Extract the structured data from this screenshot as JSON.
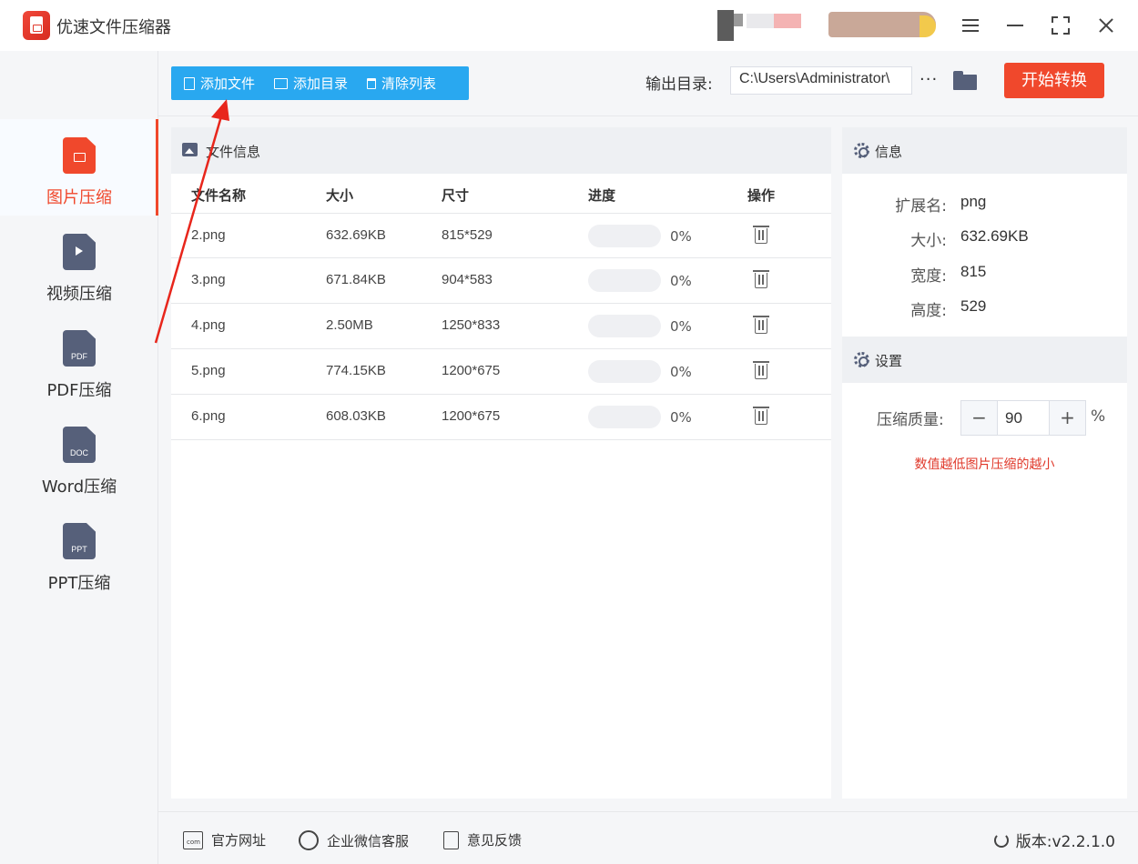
{
  "app": {
    "title": "优速文件压缩器"
  },
  "sidebar": {
    "items": [
      {
        "label": "图片压缩",
        "icon": "image-file-icon",
        "active": true
      },
      {
        "label": "视频压缩",
        "icon": "video-file-icon",
        "tag": ""
      },
      {
        "label": "PDF压缩",
        "icon": "pdf-file-icon",
        "tag": "PDF"
      },
      {
        "label": "Word压缩",
        "icon": "doc-file-icon",
        "tag": "DOC"
      },
      {
        "label": "PPT压缩",
        "icon": "ppt-file-icon",
        "tag": "PPT"
      }
    ]
  },
  "toolbar": {
    "add_file": "添加文件",
    "add_dir": "添加目录",
    "clear_list": "清除列表",
    "output_label": "输出目录:",
    "output_path": "C:\\Users\\Administrator\\",
    "more": "···",
    "start": "开始转换"
  },
  "file_panel": {
    "title": "文件信息",
    "columns": [
      "文件名称",
      "大小",
      "尺寸",
      "进度",
      "操作"
    ],
    "rows": [
      {
        "name": "2.png",
        "size": "632.69KB",
        "dims": "815*529",
        "progress": "0%",
        "progress_value": 0
      },
      {
        "name": "3.png",
        "size": "671.84KB",
        "dims": "904*583",
        "progress": "0%",
        "progress_value": 0
      },
      {
        "name": "4.png",
        "size": "2.50MB",
        "dims": "1250*833",
        "progress": "0%",
        "progress_value": 0
      },
      {
        "name": "5.png",
        "size": "774.15KB",
        "dims": "1200*675",
        "progress": "0%",
        "progress_value": 0
      },
      {
        "name": "6.png",
        "size": "608.03KB",
        "dims": "1200*675",
        "progress": "0%",
        "progress_value": 0
      }
    ]
  },
  "info_panel": {
    "title": "信息",
    "fields": [
      {
        "key": "扩展名:",
        "value": "png"
      },
      {
        "key": "大小:",
        "value": "632.69KB"
      },
      {
        "key": "宽度:",
        "value": "815"
      },
      {
        "key": "高度:",
        "value": "529"
      }
    ]
  },
  "settings": {
    "title": "设置",
    "quality_label": "压缩质量:",
    "minus": "−",
    "plus": "+",
    "quality_value": "90",
    "unit": "%",
    "hint": "数值越低图片压缩的越小"
  },
  "footer": {
    "website": "官方网址",
    "wechat": "企业微信客服",
    "feedback": "意见反馈",
    "version": "版本:v2.2.1.0"
  },
  "colors": {
    "accent": "#f0482c",
    "toolbar_blue": "#29a8f0",
    "icon_gray": "#56607a"
  }
}
